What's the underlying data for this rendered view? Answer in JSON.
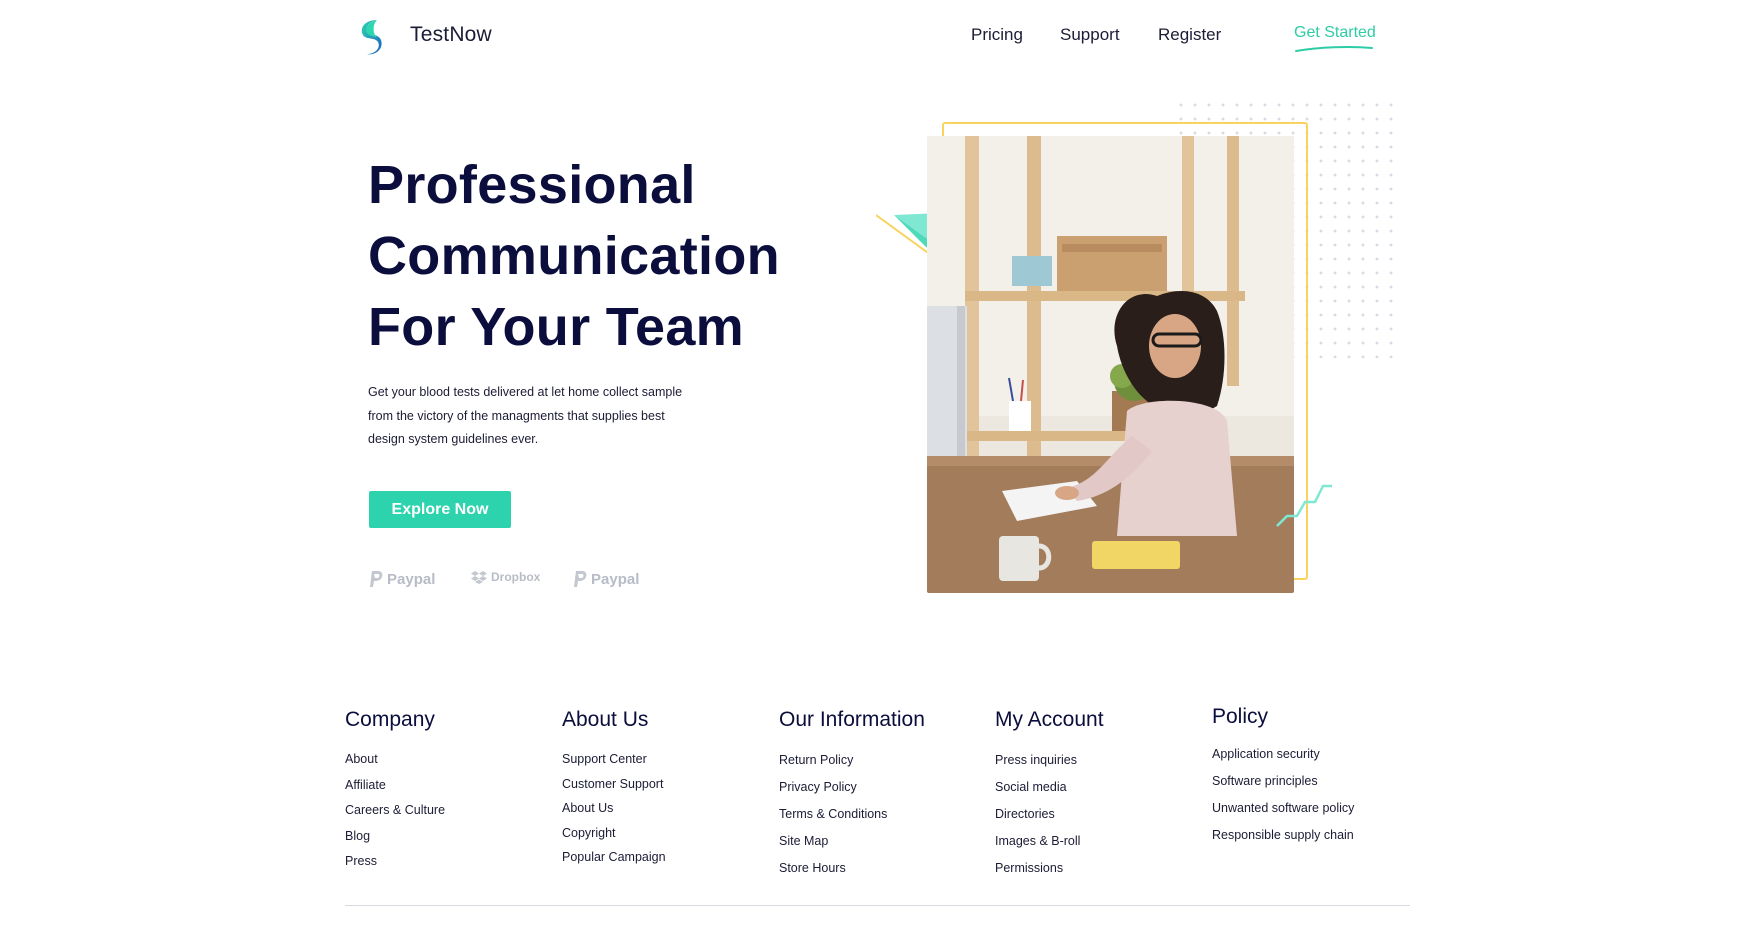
{
  "header": {
    "brand": "TestNow",
    "nav": [
      "Pricing",
      "Support",
      "Register"
    ],
    "cta": "Get Started"
  },
  "hero": {
    "headline": [
      "Professional",
      "Communication",
      "For Your Team"
    ],
    "description": [
      "Get your blood tests delivered at let home collect sample",
      "from the victory of the managments that supplies best",
      "design system guidelines ever."
    ],
    "button": "Explore Now",
    "partners": [
      "Paypal",
      "Dropbox",
      "Paypal"
    ]
  },
  "footer": {
    "columns": [
      {
        "title": "Company",
        "links": [
          "About",
          "Affiliate",
          "Careers & Culture",
          "Blog",
          "Press"
        ]
      },
      {
        "title": "About Us",
        "links": [
          "Support Center",
          "Customer Support",
          "About Us",
          "Copyright",
          "Popular Campaign"
        ]
      },
      {
        "title": "Our Information",
        "links": [
          "Return Policy",
          "Privacy Policy",
          "Terms & Conditions",
          "Site Map",
          "Store Hours"
        ]
      },
      {
        "title": "My Account",
        "links": [
          "Press inquiries",
          "Social media",
          "Directories",
          "Images & B-roll",
          "Permissions"
        ]
      },
      {
        "title": "Policy",
        "links": [
          "Application security",
          "Software principles",
          "Unwanted software policy",
          "Responsible supply chain"
        ]
      }
    ]
  },
  "colors": {
    "accent": "#2dd3ad",
    "heading": "#0b0d3d",
    "frame": "#f8d35e",
    "partner_gray": "#b8bcc6"
  },
  "icons": {
    "logo": "testnow-logo-icon",
    "paypal": "paypal-icon",
    "dropbox": "dropbox-icon"
  }
}
